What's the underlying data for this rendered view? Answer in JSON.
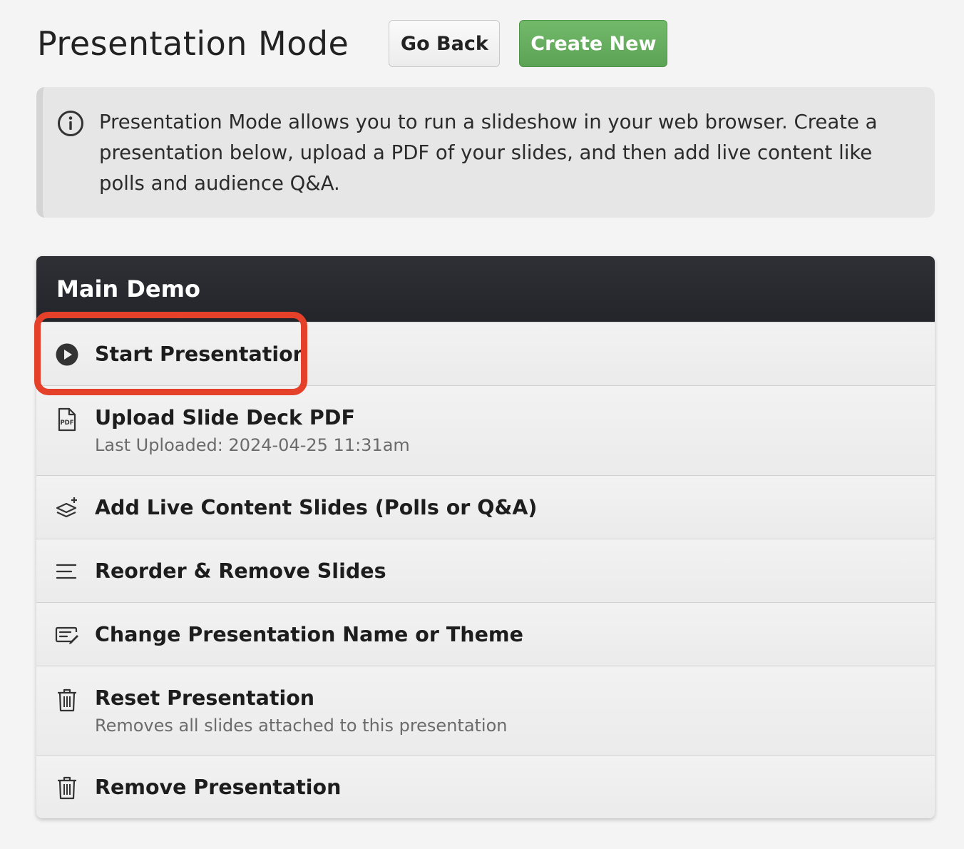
{
  "header": {
    "title": "Presentation Mode",
    "go_back_label": "Go Back",
    "create_new_label": "Create New"
  },
  "info": {
    "icon": "info-icon",
    "text": "Presentation Mode allows you to run a slideshow in your web browser. Create a presentation below, upload a PDF of your slides, and then add live content like polls and audience Q&A."
  },
  "panel": {
    "title": "Main Demo",
    "rows": [
      {
        "label": "Start Presentation",
        "icon": "play-icon"
      },
      {
        "label": "Upload Slide Deck PDF",
        "sub": "Last Uploaded: 2024-04-25 11:31am",
        "icon": "pdf-file-icon"
      },
      {
        "label": "Add Live Content Slides (Polls or Q&A)",
        "icon": "layers-plus-icon"
      },
      {
        "label": "Reorder & Remove Slides",
        "icon": "lines-icon"
      },
      {
        "label": "Change Presentation Name or Theme",
        "icon": "edit-icon"
      },
      {
        "label": "Reset Presentation",
        "sub": "Removes all slides attached to this presentation",
        "icon": "trash-icon"
      },
      {
        "label": "Remove Presentation",
        "icon": "trash-icon"
      }
    ]
  },
  "colors": {
    "create_new": "#67ae60",
    "panel_header": "#2a2c31",
    "highlight": "#e5402a"
  }
}
